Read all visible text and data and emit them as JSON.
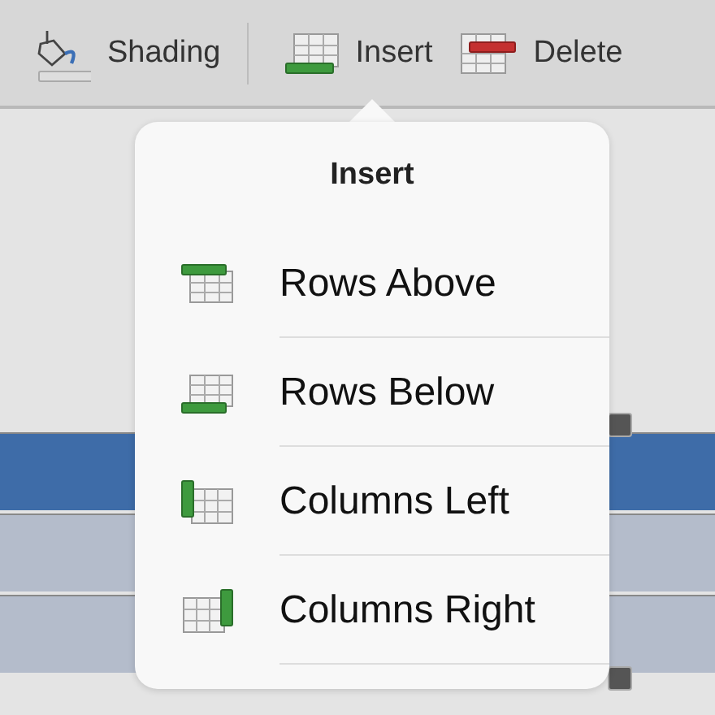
{
  "toolbar": [
    {
      "kind": "shading",
      "label": "Shading"
    },
    {
      "kind": "insert",
      "label": "Insert"
    },
    {
      "kind": "delete",
      "label": "Delete"
    }
  ],
  "popover": {
    "title": "Insert",
    "items": [
      {
        "kind": "rows-above",
        "label": "Rows Above"
      },
      {
        "kind": "rows-below",
        "label": "Rows Below"
      },
      {
        "kind": "columns-left",
        "label": "Columns Left"
      },
      {
        "kind": "columns-right",
        "label": "Columns Right"
      }
    ]
  },
  "table": {
    "rows": [
      {
        "selected": true
      },
      {
        "selected": false
      },
      {
        "selected": false
      }
    ]
  }
}
